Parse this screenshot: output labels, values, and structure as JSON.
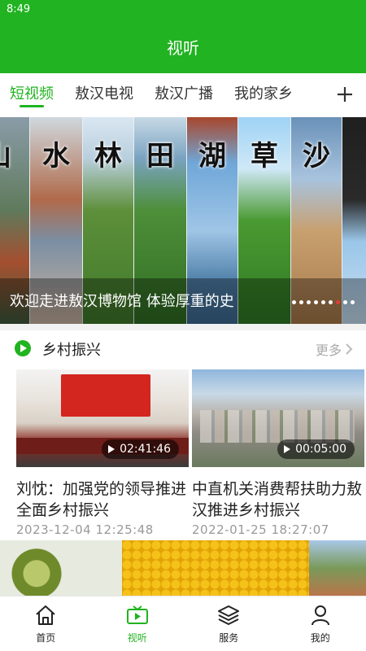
{
  "status_bar": {
    "time": "8:49"
  },
  "header": {
    "title": "视听"
  },
  "tabs": [
    {
      "label": "短视频",
      "active": true
    },
    {
      "label": "敖汉电视",
      "active": false
    },
    {
      "label": "敖汉广播",
      "active": false
    },
    {
      "label": "我的家乡",
      "active": false
    }
  ],
  "add_tab_icon": "plus-icon",
  "banner": {
    "panels": [
      {
        "glyph": "山"
      },
      {
        "glyph": "水"
      },
      {
        "glyph": "林"
      },
      {
        "glyph": "田"
      },
      {
        "glyph": "湖"
      },
      {
        "glyph": "草"
      },
      {
        "glyph": "沙"
      },
      {
        "glyph": ""
      }
    ],
    "caption": "欢迎走进敖汉博物馆  体验厚重的史",
    "dot_count": 9,
    "active_dot": 6
  },
  "section": {
    "title": "乡村振兴",
    "more_label": "更多",
    "icon": "play-circle-icon"
  },
  "videos": [
    {
      "title": "刘忱：加强党的领导推进全面乡村振兴",
      "date": "2023-12-04  12:25:48",
      "duration": "02:41:46"
    },
    {
      "title": "中直机关消费帮扶助力敖汉推进乡村振兴",
      "date": "2022-01-25  18:27:07",
      "duration": "00:05:00"
    }
  ],
  "nav": [
    {
      "label": "首页",
      "icon": "home-icon",
      "active": false
    },
    {
      "label": "视听",
      "icon": "tv-icon",
      "active": true
    },
    {
      "label": "服务",
      "icon": "layers-icon",
      "active": false
    },
    {
      "label": "我的",
      "icon": "user-icon",
      "active": false
    }
  ],
  "colors": {
    "brand": "#21b321",
    "active_dot": "#e23b3b"
  }
}
